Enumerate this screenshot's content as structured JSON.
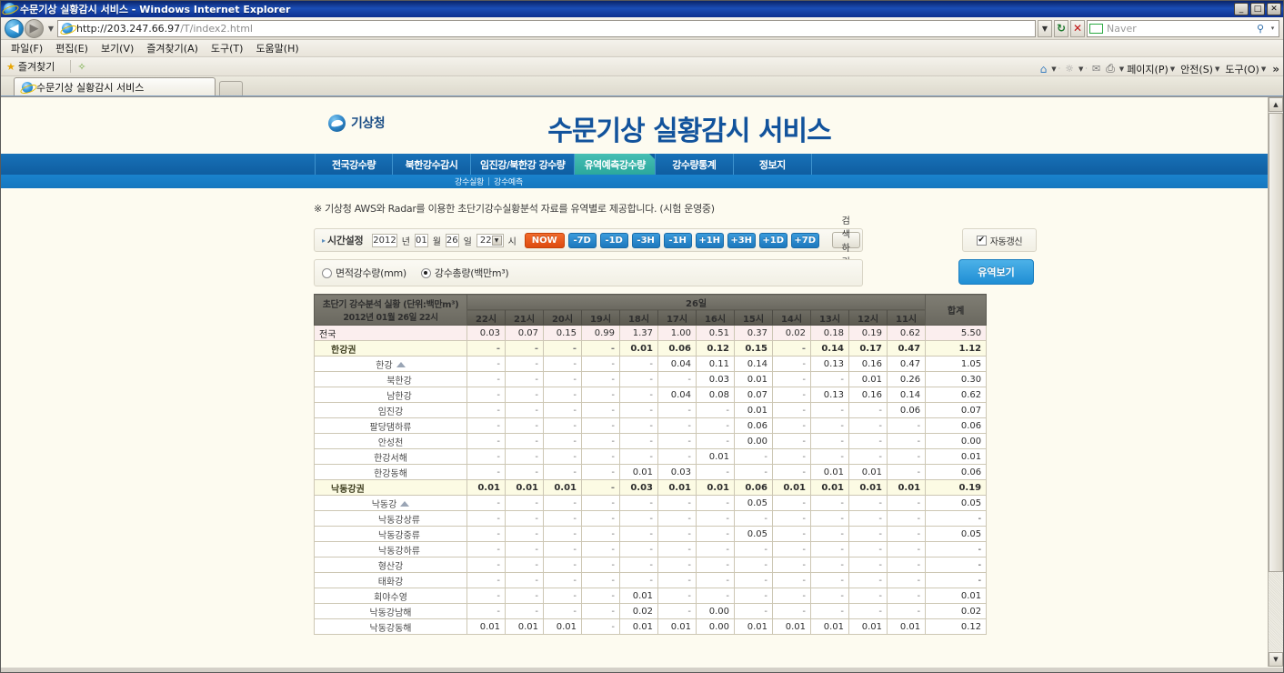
{
  "browser": {
    "title": "수문기상 실황감시 서비스 - Windows Internet Explorer",
    "window_buttons": {
      "minimize": "_",
      "maximize": "□",
      "close": "✕"
    },
    "address": {
      "url_protocol": "http://",
      "url_host": "203.247.66.97",
      "url_path": "/T/index2.html"
    },
    "address_icons": {
      "back": "◀",
      "forward": "▶",
      "dropdown": "▼",
      "refresh": "↻",
      "stop": "✕",
      "go": "🔍"
    },
    "search": {
      "placeholder": "Naver",
      "caret": "▾"
    },
    "menus": [
      {
        "label": "파일(F)"
      },
      {
        "label": "편집(E)"
      },
      {
        "label": "보기(V)"
      },
      {
        "label": "즐겨찾기(A)"
      },
      {
        "label": "도구(T)"
      },
      {
        "label": "도움말(H)"
      }
    ],
    "favorites": {
      "label": "즐겨찾기"
    },
    "command_bar": [
      {
        "label": "페이지(P)"
      },
      {
        "label": "안전(S)"
      },
      {
        "label": "도구(O)"
      }
    ],
    "command_more": "»",
    "tab": {
      "label": "수문기상 실황감시 서비스"
    }
  },
  "site": {
    "logo_text": "기상청",
    "title": "수문기상 실황감시 서비스",
    "nav": [
      {
        "label": "전국강수량",
        "active": false
      },
      {
        "label": "북한강수감시",
        "active": false
      },
      {
        "label": "임진강/북한강 강수량",
        "active": false
      },
      {
        "label": "유역예측강수량",
        "active": true
      },
      {
        "label": "강수량통계",
        "active": false
      },
      {
        "label": "정보지",
        "active": false
      }
    ],
    "subnav": [
      {
        "label": "강수실황"
      },
      {
        "label": "강수예측"
      }
    ],
    "subnav_separator": "|",
    "notice": "※ 기상청 AWS와 Radar를 이용한 초단기강수실황분석 자료를 유역별로 제공합니다. (시험 운영중)"
  },
  "controls": {
    "time_label": "시간설정",
    "time_arrow": "▸",
    "year": "2012",
    "year_unit": "년",
    "month": "01",
    "month_unit": "월",
    "day": "26",
    "day_unit": "일",
    "hour": "22",
    "hour_unit": "시",
    "now_button": "NOW",
    "step_buttons": [
      "-7D",
      "-1D",
      "-3H",
      "-1H",
      "+1H",
      "+3H",
      "+1D",
      "+7D"
    ],
    "search_button": "검색하기",
    "auto_refresh": {
      "label": "자동갱신",
      "checked": true,
      "mark": "✔"
    },
    "radio_options": [
      {
        "label": "면적강수량(mm)",
        "selected": false
      },
      {
        "label": "강수총량(백만m³)",
        "selected": true
      }
    ],
    "basin_button": "유역보기"
  },
  "table": {
    "corner_title": "초단기 강수분석 실황 (단위:백만m³)",
    "corner_subtitle": "2012년 01월 26일 22시",
    "day_group": "26일",
    "total_header": "합계",
    "hours": [
      "22시",
      "21시",
      "20시",
      "19시",
      "18시",
      "17시",
      "16시",
      "15시",
      "14시",
      "13시",
      "12시",
      "11시"
    ],
    "rows": [
      {
        "label": "전국",
        "type": "national",
        "icon": false,
        "values": [
          "0.03",
          "0.07",
          "0.15",
          "0.99",
          "1.37",
          "1.00",
          "0.51",
          "0.37",
          "0.02",
          "0.18",
          "0.19",
          "0.62"
        ],
        "total": "5.50"
      },
      {
        "label": "한강권",
        "type": "region",
        "icon": false,
        "values": [
          "-",
          "-",
          "-",
          "-",
          "0.01",
          "0.06",
          "0.12",
          "0.15",
          "-",
          "0.14",
          "0.17",
          "0.47"
        ],
        "total": "1.12"
      },
      {
        "label": "한강",
        "type": "sub",
        "icon": true,
        "values": [
          "-",
          "-",
          "-",
          "-",
          "-",
          "0.04",
          "0.11",
          "0.14",
          "-",
          "0.13",
          "0.16",
          "0.47"
        ],
        "total": "1.05"
      },
      {
        "label": "북한강",
        "type": "sub2",
        "icon": false,
        "values": [
          "-",
          "-",
          "-",
          "-",
          "-",
          "-",
          "0.03",
          "0.01",
          "-",
          "-",
          "0.01",
          "0.26"
        ],
        "total": "0.30"
      },
      {
        "label": "남한강",
        "type": "sub2",
        "icon": false,
        "values": [
          "-",
          "-",
          "-",
          "-",
          "-",
          "0.04",
          "0.08",
          "0.07",
          "-",
          "0.13",
          "0.16",
          "0.14"
        ],
        "total": "0.62"
      },
      {
        "label": "임진강",
        "type": "sub",
        "icon": false,
        "values": [
          "-",
          "-",
          "-",
          "-",
          "-",
          "-",
          "-",
          "0.01",
          "-",
          "-",
          "-",
          "0.06"
        ],
        "total": "0.07"
      },
      {
        "label": "팔당댐하류",
        "type": "sub",
        "icon": false,
        "values": [
          "-",
          "-",
          "-",
          "-",
          "-",
          "-",
          "-",
          "0.06",
          "-",
          "-",
          "-",
          "-"
        ],
        "total": "0.06"
      },
      {
        "label": "안성천",
        "type": "sub",
        "icon": false,
        "values": [
          "-",
          "-",
          "-",
          "-",
          "-",
          "-",
          "-",
          "0.00",
          "-",
          "-",
          "-",
          "-"
        ],
        "total": "0.00"
      },
      {
        "label": "한강서해",
        "type": "sub",
        "icon": false,
        "values": [
          "-",
          "-",
          "-",
          "-",
          "-",
          "-",
          "0.01",
          "-",
          "-",
          "-",
          "-",
          "-"
        ],
        "total": "0.01"
      },
      {
        "label": "한강동해",
        "type": "sub",
        "icon": false,
        "values": [
          "-",
          "-",
          "-",
          "-",
          "0.01",
          "0.03",
          "-",
          "-",
          "-",
          "0.01",
          "0.01",
          "-"
        ],
        "total": "0.06"
      },
      {
        "label": "낙동강권",
        "type": "region",
        "icon": false,
        "values": [
          "0.01",
          "0.01",
          "0.01",
          "-",
          "0.03",
          "0.01",
          "0.01",
          "0.06",
          "0.01",
          "0.01",
          "0.01",
          "0.01"
        ],
        "total": "0.19"
      },
      {
        "label": "낙동강",
        "type": "sub",
        "icon": true,
        "values": [
          "-",
          "-",
          "-",
          "-",
          "-",
          "-",
          "-",
          "0.05",
          "-",
          "-",
          "-",
          "-"
        ],
        "total": "0.05"
      },
      {
        "label": "낙동강상류",
        "type": "sub2",
        "icon": false,
        "values": [
          "-",
          "-",
          "-",
          "-",
          "-",
          "-",
          "-",
          "-",
          "-",
          "-",
          "-",
          "-"
        ],
        "total": "-"
      },
      {
        "label": "낙동강중류",
        "type": "sub2",
        "icon": false,
        "values": [
          "-",
          "-",
          "-",
          "-",
          "-",
          "-",
          "-",
          "0.05",
          "-",
          "-",
          "-",
          "-"
        ],
        "total": "0.05"
      },
      {
        "label": "낙동강하류",
        "type": "sub2",
        "icon": false,
        "values": [
          "-",
          "-",
          "-",
          "-",
          "-",
          "-",
          "-",
          "-",
          "-",
          "-",
          "-",
          "-"
        ],
        "total": "-"
      },
      {
        "label": "형산강",
        "type": "sub",
        "icon": false,
        "values": [
          "-",
          "-",
          "-",
          "-",
          "-",
          "-",
          "-",
          "-",
          "-",
          "-",
          "-",
          "-"
        ],
        "total": "-"
      },
      {
        "label": "태화강",
        "type": "sub",
        "icon": false,
        "values": [
          "-",
          "-",
          "-",
          "-",
          "-",
          "-",
          "-",
          "-",
          "-",
          "-",
          "-",
          "-"
        ],
        "total": "-"
      },
      {
        "label": "회야수영",
        "type": "sub",
        "icon": false,
        "values": [
          "-",
          "-",
          "-",
          "-",
          "0.01",
          "-",
          "-",
          "-",
          "-",
          "-",
          "-",
          "-"
        ],
        "total": "0.01"
      },
      {
        "label": "낙동강남해",
        "type": "sub",
        "icon": false,
        "values": [
          "-",
          "-",
          "-",
          "-",
          "0.02",
          "-",
          "0.00",
          "-",
          "-",
          "-",
          "-",
          "-"
        ],
        "total": "0.02"
      },
      {
        "label": "낙동강동해",
        "type": "sub",
        "icon": false,
        "values": [
          "0.01",
          "0.01",
          "0.01",
          "-",
          "0.01",
          "0.01",
          "0.00",
          "0.01",
          "0.01",
          "0.01",
          "0.01",
          "0.01"
        ],
        "total": "0.12"
      }
    ]
  },
  "scrollbar": {
    "up": "▲",
    "down": "▼"
  }
}
